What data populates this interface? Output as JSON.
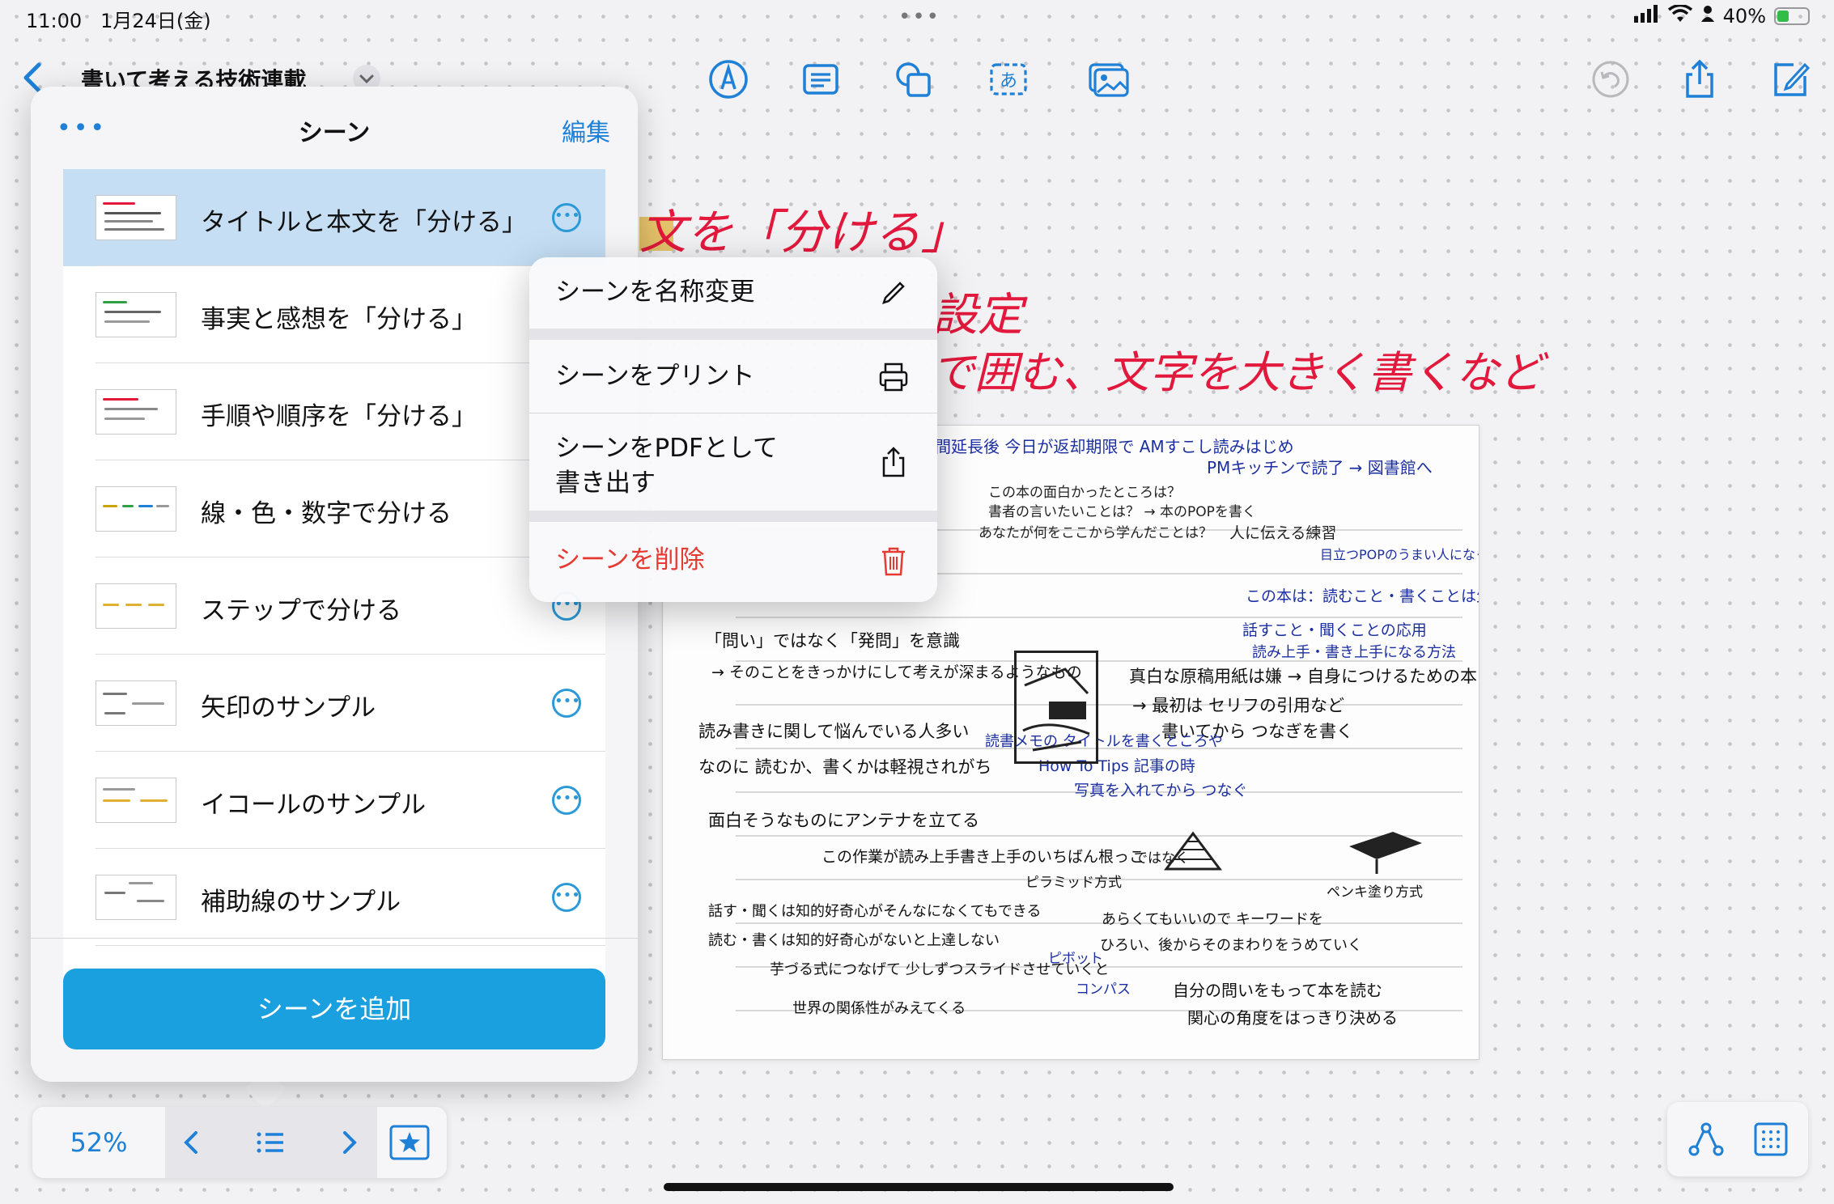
{
  "status_bar": {
    "time": "11:00",
    "date": "1月24日(金)",
    "dots": "•••",
    "battery": "40%",
    "battery_level": 0.4
  },
  "toolbar": {
    "title": "書いて考える技術連載",
    "icons": [
      "pen-tool-icon",
      "note-icon",
      "shapes-icon",
      "text-box-icon",
      "photo-icon",
      "undo-icon",
      "share-icon",
      "compose-icon"
    ],
    "text_box_glyph": "あ"
  },
  "canvas": {
    "headline_1": "文を「分ける」",
    "headline_2": "設定",
    "headline_3": "で囲む、文字を大きく書くなど",
    "notes": [
      "間延長後 今日が返却期限で AMすこし読みはじめ",
      "PMキッチンで読了 → 図書館へ",
      "この本の面白かったところは？",
      "書者の言いたいことは？ → 本のPOPを書く",
      "あなたが何をここから学んだことは？",
      "人に伝える練習",
      "目立つPOPのうまい人になって競争の",
      "この本は：読むこと・書くことは生き残る",
      "話すこと・聞くことの応用",
      "読み上手・書き上手になる方法",
      "真白な原稿用紙は嫌 → 自身につけるための本",
      "→ 最初は セリフの引用など",
      "書いてから つなぎを書く",
      "「問い」ではなく「発問」を意識",
      "→ そのことをきっかけにして考えが深まるようなもの",
      "読み書きに関して悩んでいる人多い",
      "なのに 読むか、書くかは軽視されがち",
      "読書メモの タイトルを書くところや",
      "How To Tips 記事の時",
      "写真を入れてから つなぐ",
      "面白そうなものにアンテナを立てる",
      "この作業が読み上手書き上手のいちばん根っこ",
      "ピラミッド方式",
      "ではなく",
      "ペンキ塗り方式",
      "話す・聞くは知的好奇心がそんなになくてもできる",
      "読む・書くは知的好奇心がないと上達しない",
      "あらくてもいいので キーワードを",
      "ひろい、後からそのまわりをうめていく",
      "芋づる式につなげて 少しずつスライドさせていくと",
      "世界の関係性がみえてくる",
      "ピボット",
      "コンパス",
      "自分の問いをもって本を読む",
      "関心の角度をはっきり決める"
    ]
  },
  "scene_panel": {
    "more": "•••",
    "title": "シーン",
    "edit": "編集",
    "scenes": [
      {
        "label": "タイトルと本文を「分ける」",
        "selected": true
      },
      {
        "label": "事実と感想を「分ける」",
        "selected": false
      },
      {
        "label": "手順や順序を「分ける」",
        "selected": false
      },
      {
        "label": "線・色・数字で分ける",
        "selected": false
      },
      {
        "label": "ステップで分ける",
        "selected": false
      },
      {
        "label": "矢印のサンプル",
        "selected": false
      },
      {
        "label": "イコールのサンプル",
        "selected": false
      },
      {
        "label": "補助線のサンプル",
        "selected": false
      }
    ],
    "more_button_glyph": "•••",
    "add_button": "シーンを追加"
  },
  "context_menu": {
    "items": [
      {
        "label": "シーンを名称変更",
        "icon": "pencil-icon"
      },
      {
        "label": "シーンをプリント",
        "icon": "printer-icon"
      },
      {
        "label": "シーンをPDFとして書き出す",
        "line1": "シーンをPDFとして",
        "line2": "書き出す",
        "icon": "share-icon"
      },
      {
        "label": "シーンを削除",
        "icon": "trash-icon",
        "destructive": true
      }
    ]
  },
  "bottom_bar": {
    "zoom": "52%"
  },
  "colors": {
    "accent": "#1e80d6",
    "add_button": "#1a9fdf",
    "selected_row": "#c5def4",
    "destructive": "#e53a32",
    "headline_red": "#e2183c",
    "battery_green": "#2fbd48"
  }
}
